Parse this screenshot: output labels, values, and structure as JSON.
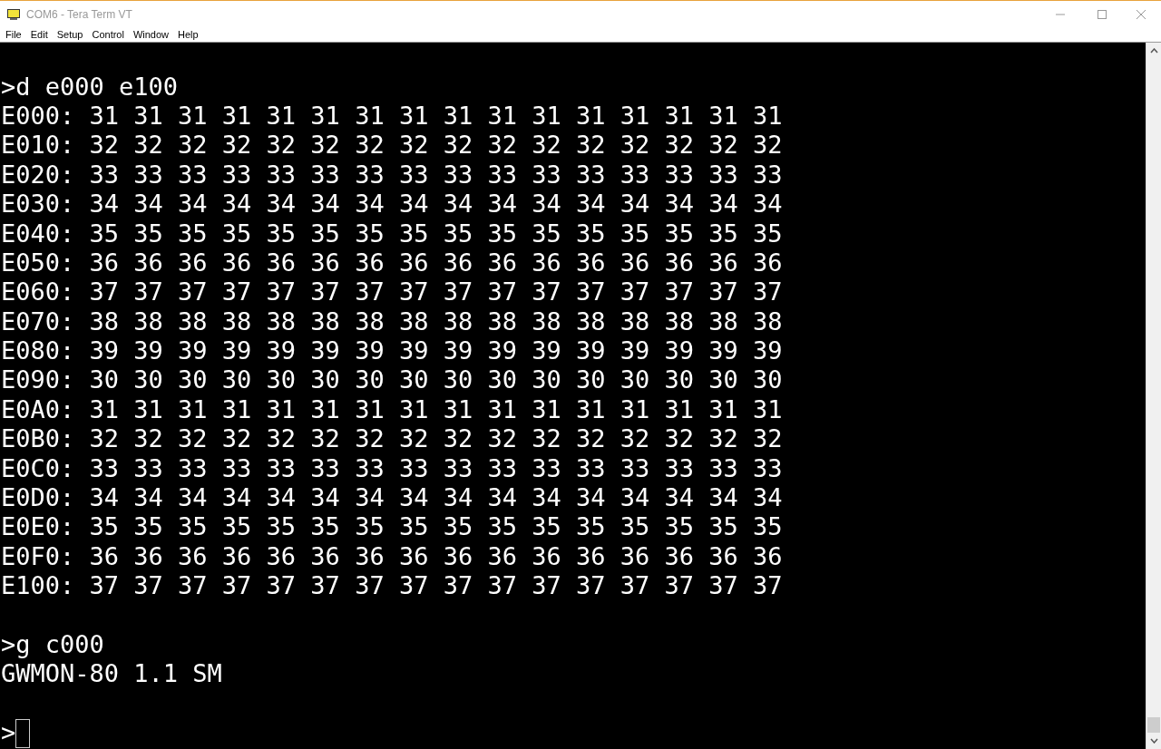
{
  "window": {
    "title": "COM6 - Tera Term VT"
  },
  "menu": [
    "File",
    "Edit",
    "Setup",
    "Control",
    "Window",
    "Help"
  ],
  "terminal": {
    "blocks": [
      [
        ">d e000 e100",
        "E000: 31 31 31 31 31 31 31 31 31 31 31 31 31 31 31 31",
        "E010: 32 32 32 32 32 32 32 32 32 32 32 32 32 32 32 32",
        "E020: 33 33 33 33 33 33 33 33 33 33 33 33 33 33 33 33",
        "E030: 34 34 34 34 34 34 34 34 34 34 34 34 34 34 34 34",
        "E040: 35 35 35 35 35 35 35 35 35 35 35 35 35 35 35 35",
        "E050: 36 36 36 36 36 36 36 36 36 36 36 36 36 36 36 36",
        "E060: 37 37 37 37 37 37 37 37 37 37 37 37 37 37 37 37",
        "E070: 38 38 38 38 38 38 38 38 38 38 38 38 38 38 38 38",
        "E080: 39 39 39 39 39 39 39 39 39 39 39 39 39 39 39 39",
        "E090: 30 30 30 30 30 30 30 30 30 30 30 30 30 30 30 30",
        "E0A0: 31 31 31 31 31 31 31 31 31 31 31 31 31 31 31 31",
        "E0B0: 32 32 32 32 32 32 32 32 32 32 32 32 32 32 32 32",
        "E0C0: 33 33 33 33 33 33 33 33 33 33 33 33 33 33 33 33",
        "E0D0: 34 34 34 34 34 34 34 34 34 34 34 34 34 34 34 34",
        "E0E0: 35 35 35 35 35 35 35 35 35 35 35 35 35 35 35 35",
        "E0F0: 36 36 36 36 36 36 36 36 36 36 36 36 36 36 36 36",
        "E100: 37 37 37 37 37 37 37 37 37 37 37 37 37 37 37 37"
      ],
      [
        ">g c000",
        "GWMON-80 1.1 SM"
      ],
      [
        ">"
      ]
    ]
  }
}
